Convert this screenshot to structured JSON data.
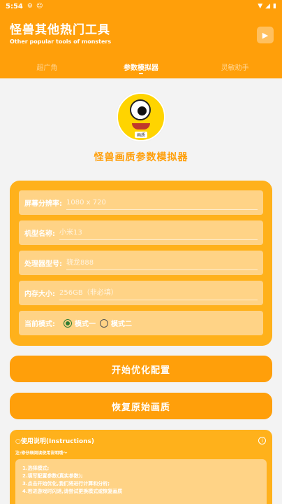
{
  "status_bar": {
    "time": "5:54",
    "icons": [
      "settings-icon",
      "ghost-icon",
      "wifi-icon",
      "signal-icon",
      "battery-icon"
    ]
  },
  "header": {
    "title": "怪兽其他热门工具",
    "subtitle": "Other popular tools of monsters",
    "play_icon": "▶"
  },
  "tabs": [
    {
      "label": "超广角",
      "active": false
    },
    {
      "label": "参数模拟器",
      "active": true
    },
    {
      "label": "灵敏助手",
      "active": false
    }
  ],
  "mascot": {
    "tag": "画质"
  },
  "page_heading": "怪兽画质参数模拟器",
  "form": {
    "resolution_label": "屏幕分辨率:",
    "resolution_placeholder": "1080 x 720",
    "model_label": "机型名称:",
    "model_placeholder": "小米13",
    "processor_label": "处理器型号:",
    "processor_placeholder": "骁龙888",
    "memory_label": "内存大小:",
    "memory_placeholder": "256GB（非必填）",
    "mode_label": "当前模式:",
    "mode_one": "模式一",
    "mode_two": "模式二",
    "selected_mode": "模式一"
  },
  "buttons": {
    "optimize": "开始优化配置",
    "restore": "恢复原始画质"
  },
  "instructions": {
    "title": "○使用说明(Instructions)",
    "info_icon": "i",
    "hint": "注:修仔细阅读使用说明哦～",
    "steps": [
      "1.选择模式;",
      "2.填写配置参数(真实参数);",
      "3.点击开始优化,我们将进行计算和分析;",
      "4.若进游戏时闪退,请尝试更换模式或恢复画质"
    ]
  },
  "colors": {
    "accent": "#ff9f0a",
    "card": "#ffb11b",
    "field": "#ffd386",
    "background": "#f3f3f3"
  }
}
